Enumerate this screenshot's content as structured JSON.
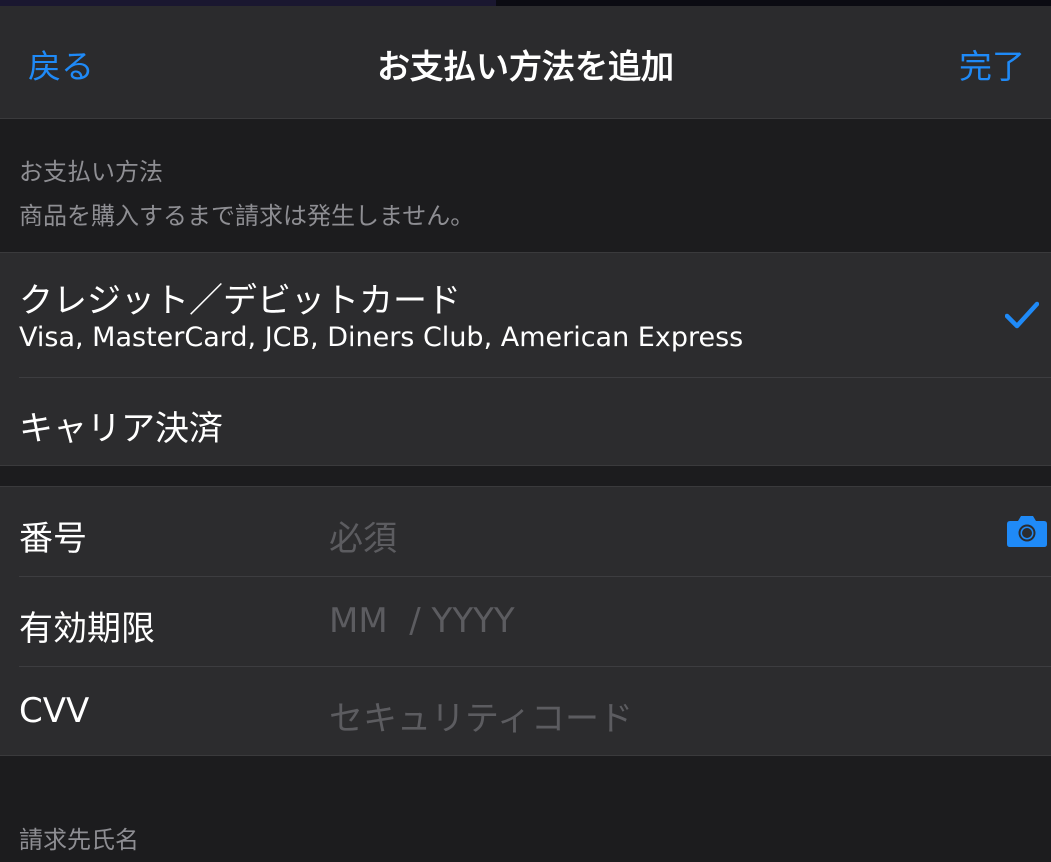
{
  "nav": {
    "back_label": "戻る",
    "title": "お支払い方法を追加",
    "done_label": "完了"
  },
  "payment_section": {
    "header": "お支払い方法",
    "note": "商品を購入するまで請求は発生しません。"
  },
  "payment_methods": [
    {
      "label": "クレジット／デビットカード",
      "sublabel": "Visa, MasterCard, JCB, Diners Club, American Express",
      "selected": true
    },
    {
      "label": "キャリア決済",
      "selected": false
    }
  ],
  "card_fields": [
    {
      "label": "番号",
      "placeholder": "必須"
    },
    {
      "label": "有効期限",
      "placeholder": "MM  / YYYY"
    },
    {
      "label": "CVV",
      "placeholder": "セキュリティコード"
    }
  ],
  "billing_section": {
    "header": "請求先氏名"
  },
  "colors": {
    "accent": "#1f8af7",
    "background": "#1c1c1e",
    "cell": "#2c2c2e",
    "navbar": "#2b2b2d",
    "secondary_text": "#8e8e93",
    "placeholder_text": "#5c5c60"
  },
  "icons": {
    "selected_indicator": "checkmark-icon",
    "card_scanner": "camera-icon"
  }
}
